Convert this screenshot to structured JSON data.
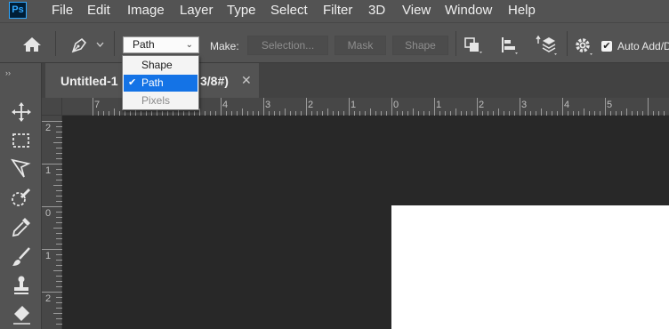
{
  "app": {
    "logo": "Ps"
  },
  "menu": [
    "File",
    "Edit",
    "Image",
    "Layer",
    "Type",
    "Select",
    "Filter",
    "3D",
    "View",
    "Window",
    "Help"
  ],
  "options": {
    "mode_value": "Path",
    "make_label": "Make:",
    "selection_button": "Selection...",
    "mask_button": "Mask",
    "shape_button": "Shape",
    "auto_add_label": "Auto Add/D"
  },
  "mode_dropdown": {
    "items": [
      {
        "label": "Shape",
        "selected": false,
        "disabled": false
      },
      {
        "label": "Path",
        "selected": true,
        "disabled": false
      },
      {
        "label": "Pixels",
        "selected": false,
        "disabled": true
      }
    ],
    "selected_accent": "#1473e6"
  },
  "document_tab": {
    "title": "Untitled-1",
    "suffix": "3/8#)"
  },
  "rulers": {
    "horizontal": [
      "7",
      "6",
      "5",
      "4",
      "3",
      "2",
      "1",
      "0",
      "1",
      "2",
      "3",
      "4",
      "5"
    ],
    "vertical": [
      "2",
      "1",
      "0",
      "1",
      "2"
    ]
  },
  "colors": {
    "chrome": "#535353",
    "pasteboard": "#282828",
    "canvas": "#ffffff"
  }
}
